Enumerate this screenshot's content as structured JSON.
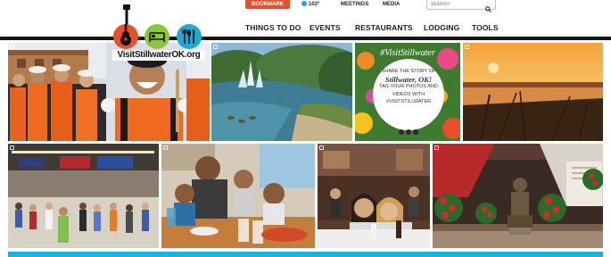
{
  "header": {
    "button_label": "BOOKMARK",
    "weather": "103°",
    "meetings": "MEETINGS",
    "media": "MEDIA",
    "search": {
      "placeholder": "SEARCH"
    }
  },
  "logo": {
    "text": "VisitStillwaterOK.org",
    "icons": [
      "guitar-icon",
      "bed-icon",
      "food-icon"
    ],
    "colors": {
      "guitar": "#e8502b",
      "bed": "#8cc63f",
      "food": "#1fa9d6"
    }
  },
  "nav": {
    "items": [
      {
        "label": "THINGS TO DO"
      },
      {
        "label": "EVENTS"
      },
      {
        "label": "RESTAURANTS"
      },
      {
        "label": "LODGING"
      },
      {
        "label": "TOOLS"
      }
    ]
  },
  "gallery": {
    "instagram_badge_icon": "instagram-icon",
    "promo": {
      "hashtag": "#VisitStillwater",
      "lines": [
        "SHARE THE STORY OF",
        "Stillwater, OK!",
        "TAG YOUR PHOTOS AND",
        "VIDEOS WITH",
        "#VISITSTILLWATER"
      ]
    }
  },
  "colors": {
    "accent_orange": "#e8502b",
    "accent_green": "#8cc63f",
    "accent_blue": "#1fa9d6",
    "footer": "#1fb3d9"
  }
}
